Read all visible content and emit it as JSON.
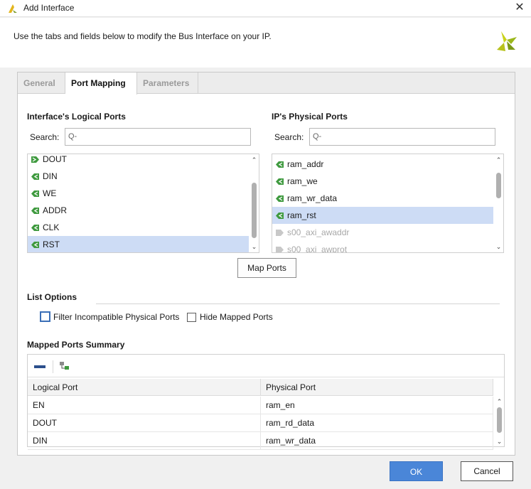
{
  "window": {
    "title": "Add Interface",
    "close_glyph": "✕"
  },
  "header": {
    "description": "Use the tabs and fields below to modify the Bus Interface on your IP."
  },
  "tabs": [
    {
      "label": "General",
      "active": false
    },
    {
      "label": "Port Mapping",
      "active": true
    },
    {
      "label": "Parameters",
      "active": false
    }
  ],
  "logical_ports": {
    "heading": "Interface's Logical Ports",
    "search_label": "Search:",
    "search_placeholder": "Q-",
    "items": [
      {
        "label": "DOUT",
        "icon": "output-port-icon",
        "selected": false,
        "enabled": true
      },
      {
        "label": "DIN",
        "icon": "input-port-icon",
        "selected": false,
        "enabled": true
      },
      {
        "label": "WE",
        "icon": "input-port-icon",
        "selected": false,
        "enabled": true
      },
      {
        "label": "ADDR",
        "icon": "input-port-icon",
        "selected": false,
        "enabled": true
      },
      {
        "label": "CLK",
        "icon": "input-port-icon",
        "selected": false,
        "enabled": true
      },
      {
        "label": "RST",
        "icon": "input-port-icon",
        "selected": true,
        "enabled": true
      }
    ]
  },
  "physical_ports": {
    "heading": "IP's Physical Ports",
    "search_label": "Search:",
    "search_placeholder": "Q-",
    "items": [
      {
        "label": "ram_addr",
        "icon": "input-port-icon",
        "selected": false,
        "enabled": true
      },
      {
        "label": "ram_we",
        "icon": "input-port-icon",
        "selected": false,
        "enabled": true
      },
      {
        "label": "ram_wr_data",
        "icon": "input-port-icon",
        "selected": false,
        "enabled": true
      },
      {
        "label": "ram_rst",
        "icon": "input-port-icon",
        "selected": true,
        "enabled": true
      },
      {
        "label": "s00_axi_awaddr",
        "icon": "disabled-port-icon",
        "selected": false,
        "enabled": false
      },
      {
        "label": "s00_axi_awprot",
        "icon": "disabled-port-icon",
        "selected": false,
        "enabled": false
      }
    ]
  },
  "map_ports_button": "Map Ports",
  "list_options": {
    "heading": "List Options",
    "filter_label": "Filter Incompatible Physical Ports",
    "filter_checked": false,
    "hide_label": "Hide Mapped Ports",
    "hide_checked": false
  },
  "summary": {
    "heading": "Mapped Ports Summary",
    "columns": [
      "Logical Port",
      "Physical Port"
    ],
    "rows": [
      [
        "EN",
        "ram_en"
      ],
      [
        "DOUT",
        "ram_rd_data"
      ],
      [
        "DIN",
        "ram_wr_data"
      ]
    ]
  },
  "footer": {
    "ok_label": "OK",
    "cancel_label": "Cancel"
  },
  "colors": {
    "accent": "#4a86d8",
    "selection": "#cddcf5",
    "port_green": "#3f9a3f"
  }
}
